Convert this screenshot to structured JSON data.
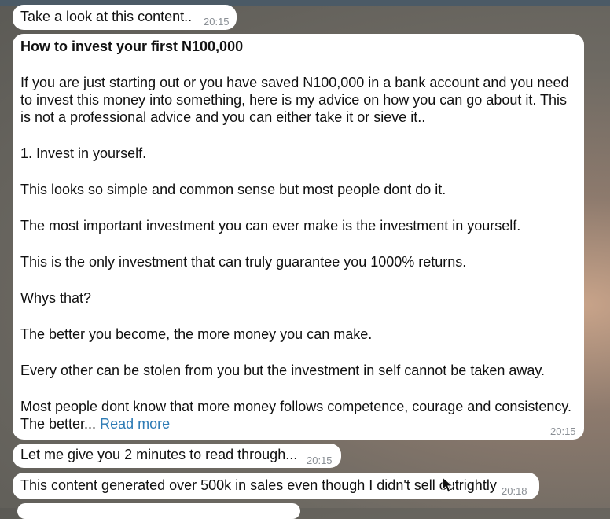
{
  "messages": [
    {
      "text": "Take a look at this content..",
      "time": "20:15"
    },
    {
      "title": "How to invest your first N100,000",
      "paragraphs": [
        "If you are just starting out or you have saved N100,000 in a bank account and you need to invest this money into something, here is my advice on how you can go about it. This is not a professional advice and you can either take it or sieve it..",
        "1. Invest in yourself.",
        "This looks so simple and common sense but most people dont do it.",
        "The most important investment you can ever make is the investment in yourself.",
        "This is the only investment that can truly guarantee you 1000% returns.",
        "Whys that?",
        "The better you become, the more money you can make.",
        "Every other can be stolen from you but the investment in self cannot be taken away."
      ],
      "last_paragraph": "Most people dont know that more money follows competence, courage and consistency. The better...",
      "read_more": "Read more",
      "time": "20:15"
    },
    {
      "text": "Let me give you 2 minutes to read through...",
      "time": "20:15"
    },
    {
      "text": "This content generated over 500k in sales even though I didn't sell outrightly",
      "time": "20:18"
    }
  ],
  "icons": {
    "cursor": "mouse-pointer-icon"
  },
  "colors": {
    "link": "#2d7bb5",
    "bubble": "#ffffff",
    "timestamp": "#8a8f95"
  }
}
